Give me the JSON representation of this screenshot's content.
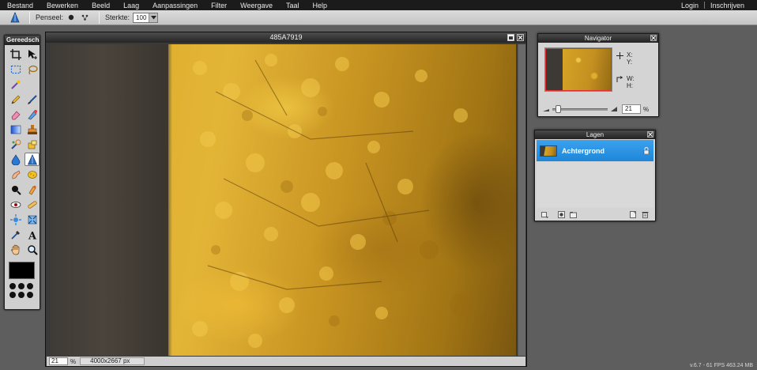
{
  "menu": {
    "items": [
      "Bestand",
      "Bewerken",
      "Beeld",
      "Laag",
      "Aanpassingen",
      "Filter",
      "Weergave",
      "Taal",
      "Help"
    ],
    "login": "Login",
    "register": "Inschrijven"
  },
  "options": {
    "brush_label": "Penseel:",
    "strength_label": "Sterkte:",
    "strength_value": "100"
  },
  "toolbox": {
    "title": "Gereedscha",
    "foreground_color": "#000000"
  },
  "document": {
    "title": "485A7919",
    "zoom": "21",
    "zoom_unit": "%",
    "dimensions": "4000x2667 px"
  },
  "navigator": {
    "title": "Navigator",
    "x_label": "X:",
    "y_label": "Y:",
    "w_label": "W:",
    "h_label": "H:",
    "zoom": "21",
    "zoom_unit": "%"
  },
  "layers": {
    "title": "Lagen",
    "items": [
      {
        "name": "Achtergrond",
        "selected": true
      }
    ]
  },
  "version": "v.6.7 - 61 FPS 463.24 MB",
  "colors": {
    "accent": "#2a93e2",
    "menubar": "#1b1b1b",
    "workspace": "#5e5e5e"
  }
}
